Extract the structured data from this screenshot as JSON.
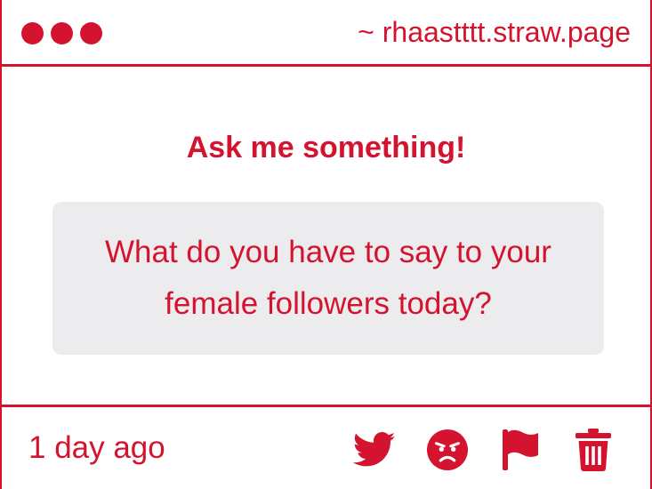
{
  "window": {
    "url": "~ rhaastttt.straw.page",
    "controls": [
      "close",
      "minimize",
      "maximize"
    ]
  },
  "main": {
    "heading": "Ask me something!",
    "question": "What do you have to say to your female followers today?"
  },
  "footer": {
    "timestamp": "1 day ago",
    "actions": [
      {
        "icon": "twitter-icon"
      },
      {
        "icon": "angry-face-icon"
      },
      {
        "icon": "flag-icon"
      },
      {
        "icon": "trash-icon"
      }
    ]
  },
  "colors": {
    "accent": "#d4142f",
    "question_background": "#ececee",
    "background": "#ffffff"
  }
}
